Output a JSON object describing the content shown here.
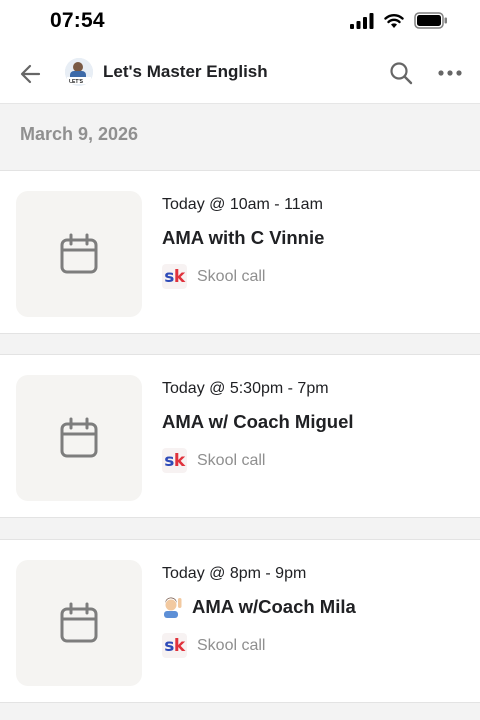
{
  "status_bar": {
    "time": "07:54"
  },
  "header": {
    "title": "Let's Master English",
    "avatar_text": "LET'S"
  },
  "date_section": {
    "label": "March 9, 2026"
  },
  "events": [
    {
      "time": "Today @ 10am - 11am",
      "title": "AMA with C Vinnie",
      "type_label": "Skool call",
      "has_emoji": false
    },
    {
      "time": "Today @ 5:30pm - 7pm",
      "title": "AMA w/ Coach Miguel",
      "type_label": "Skool call",
      "has_emoji": false
    },
    {
      "time": "Today @ 8pm - 9pm",
      "title": "AMA w/Coach Mila",
      "type_label": "Skool call",
      "has_emoji": true
    }
  ],
  "logo": {
    "s": "s",
    "k": "k"
  },
  "colors": {
    "accent_blue": "#2e4bb8",
    "accent_red": "#e0323c",
    "muted": "#8f8f8f",
    "background": "#f3f3f3"
  },
  "icons": [
    "back-arrow-icon",
    "search-icon",
    "more-icon",
    "calendar-icon",
    "signal-icon",
    "wifi-icon",
    "battery-icon",
    "skool-logo-icon",
    "person-raising-hand-icon"
  ]
}
